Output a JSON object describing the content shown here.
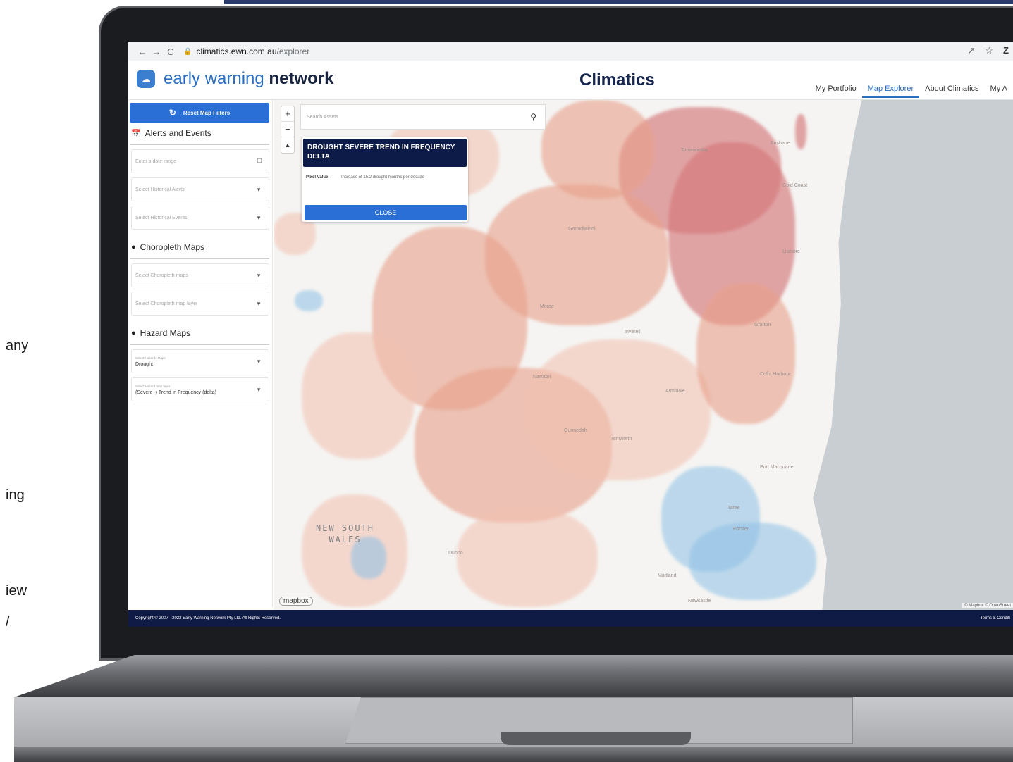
{
  "slide_fragments": [
    "any",
    "ing",
    "iew",
    "/"
  ],
  "browser": {
    "back": "←",
    "forward": "→",
    "reload": "C",
    "url_host": "climatics.ewn.com.au",
    "url_path": "/explorer",
    "right_icons": [
      "share-icon",
      "star-icon",
      "z-icon"
    ],
    "right_z": "Z"
  },
  "header": {
    "logo_light": "early warning",
    "logo_bold": "network",
    "title": "Climatics",
    "nav": [
      "My Portfolio",
      "Map Explorer",
      "About Climatics",
      "My A"
    ]
  },
  "sidebar": {
    "reset_label": "Reset Map Filters",
    "alerts_title": "Alerts and Events",
    "date_placeholder": "Enter a date range",
    "hist_alerts_placeholder": "Select Historical Alerts",
    "hist_events_placeholder": "Select Historical Events",
    "choropleth_title": "Choropleth Maps",
    "choropleth_placeholder": "Select Choropleth maps",
    "choropleth_layer_placeholder": "Select Choropleth map layer",
    "hazard_title": "Hazard Maps",
    "hazard_map_label": "Select Hazards Maps",
    "hazard_map_value": "Drought",
    "hazard_layer_label": "Select Hazard map layer",
    "hazard_layer_value": "(Severe+) Trend in Frequency (delta)"
  },
  "map": {
    "search_placeholder": "Search Assets",
    "popup_title": "DROUGHT SEVERE TREND IN FREQUENCY DELTA",
    "popup_key": "Pixel Value:",
    "popup_value": "Increase of 15.2 drought months per decade",
    "popup_close": "CLOSE",
    "state_label_line1": "NEW SOUTH",
    "state_label_line2": "WALES",
    "place_labels": [
      "Toowoomba",
      "Brisbane",
      "Gold Coast",
      "Lismore",
      "Moree",
      "Inverell",
      "Grafton",
      "Narrabri",
      "Armidale",
      "Coffs Harbour",
      "Gunnedah",
      "Tamworth",
      "Port Macquarie",
      "Taree",
      "Dubbo",
      "Forster",
      "Maitland",
      "Newcastle",
      "Goondiwindi"
    ],
    "mapbox": "mapbox",
    "attribution": "© Mapbox © OpenStreet"
  },
  "footer": {
    "copyright": "Copyright © 2007 - 2022 Early Warning Network Pty Ltd. All Rights Reserved.",
    "terms": "Terms & Conditi"
  },
  "colors": {
    "brand_blue": "#2a6fd6",
    "navy": "#0f1b44",
    "drought_increase": "#e8a08a",
    "drought_decrease": "#8ec1e6"
  }
}
